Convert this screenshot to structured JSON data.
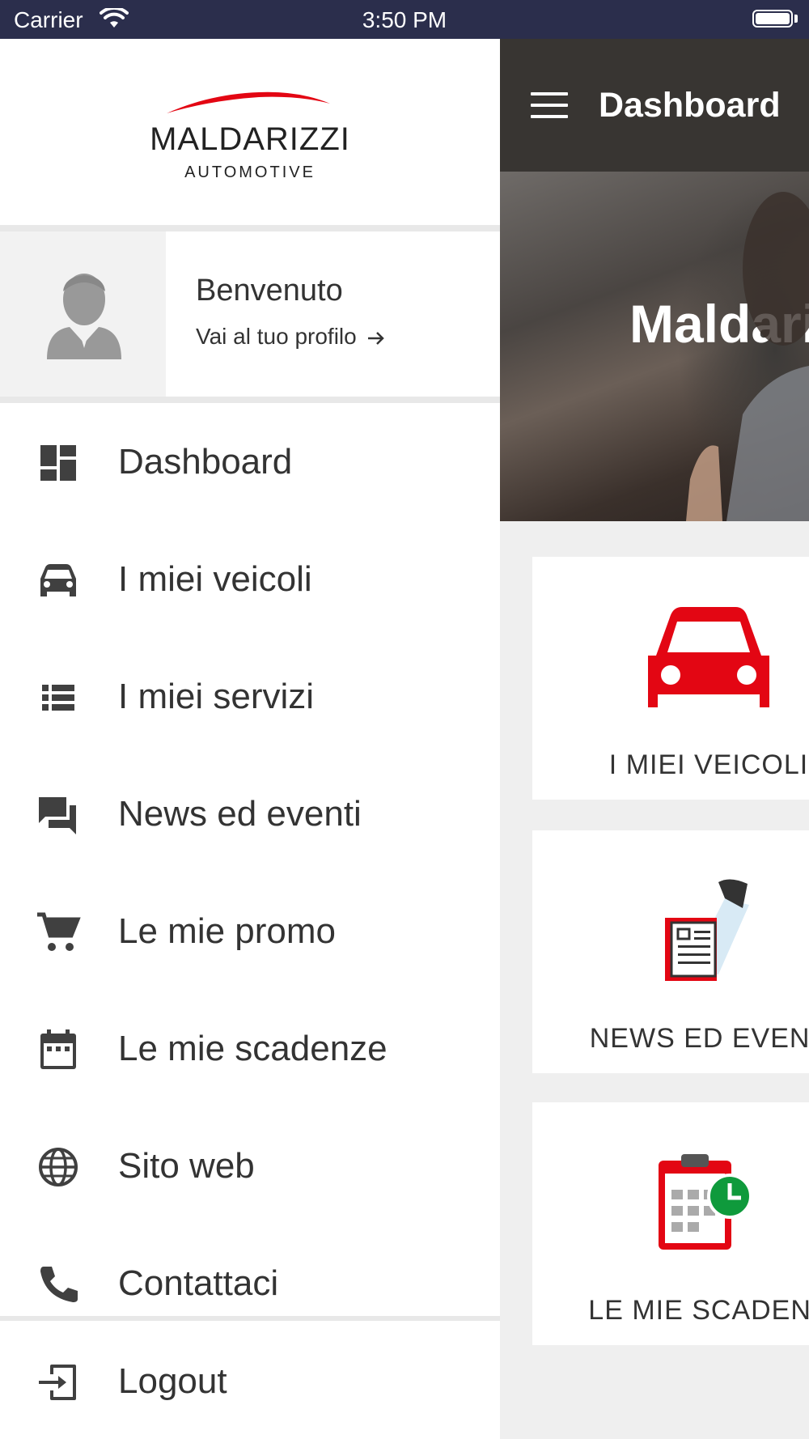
{
  "status_bar": {
    "carrier": "Carrier",
    "time": "3:50 PM"
  },
  "header": {
    "title": "Dashboard"
  },
  "hero": {
    "title": "Maldari"
  },
  "cards": [
    {
      "label": "I MIEI VEICOLI",
      "icon": "car-icon"
    },
    {
      "label": "NEWS ED EVENT",
      "icon": "newspaper-spotlight-icon"
    },
    {
      "label": "LE MIE SCADENZ",
      "icon": "calendar-clock-icon"
    }
  ],
  "drawer": {
    "brand": {
      "name": "MALDARIZZI",
      "subtitle": "AUTOMOTIVE"
    },
    "profile": {
      "welcome": "Benvenuto",
      "link": "Vai al tuo profilo"
    },
    "menu": [
      {
        "label": "Dashboard",
        "icon": "dashboard-icon"
      },
      {
        "label": "I miei veicoli",
        "icon": "car-icon"
      },
      {
        "label": "I miei servizi",
        "icon": "list-icon"
      },
      {
        "label": "News ed eventi",
        "icon": "chat-icon"
      },
      {
        "label": "Le mie promo",
        "icon": "cart-icon"
      },
      {
        "label": "Le mie scadenze",
        "icon": "calendar-icon"
      },
      {
        "label": "Sito web",
        "icon": "globe-icon"
      },
      {
        "label": "Contattaci",
        "icon": "phone-icon"
      }
    ],
    "logout": {
      "label": "Logout",
      "icon": "logout-icon"
    }
  },
  "colors": {
    "accent": "#e30613",
    "drawer_icon": "#404040",
    "header_bg": "#383532",
    "status_bg": "#2b2e4c",
    "clock_green": "#0f9a3c"
  }
}
